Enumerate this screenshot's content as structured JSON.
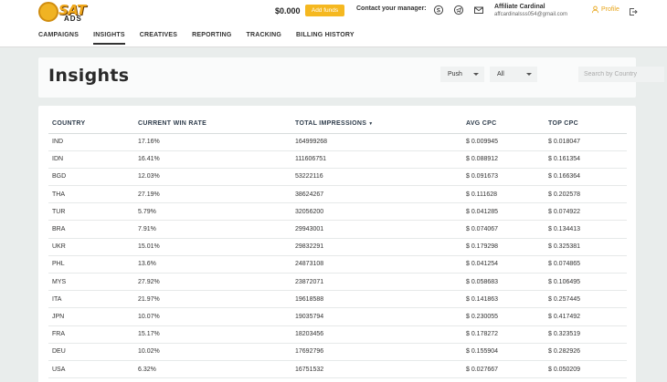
{
  "brand": {
    "logo_text": "SAT",
    "logo_sub": "ADS"
  },
  "header": {
    "balance": "$0.000",
    "add_funds_label": "Add funds",
    "manager_label": "Contact your manager:",
    "manager_icons": [
      "skype-icon",
      "telegram-icon",
      "mail-icon"
    ],
    "affiliate_name": "Affiliate Cardinal",
    "affiliate_email": "affcardinalsss054@gmail.com",
    "profile_label": "Profile"
  },
  "nav": {
    "items": [
      "CAMPAIGNS",
      "INSIGHTS",
      "CREATIVES",
      "REPORTING",
      "TRACKING",
      "BILLING HISTORY"
    ],
    "active": "INSIGHTS"
  },
  "insights": {
    "title": "Insights",
    "filter_type": "Push",
    "filter_scope": "All",
    "search_placeholder": "Search by Country"
  },
  "table": {
    "headers": {
      "country": "COUNTRY",
      "win_rate": "CURRENT WIN RATE",
      "impressions": "TOTAL IMPRESSIONS",
      "avg_cpc": "AVG CPC",
      "top_cpc": "TOP CPC"
    },
    "sort_indicator": "▼",
    "rows": [
      [
        "IND",
        "17.16%",
        "164999268",
        "$ 0.009945",
        "$ 0.018047"
      ],
      [
        "IDN",
        "16.41%",
        "111606751",
        "$ 0.088912",
        "$ 0.161354"
      ],
      [
        "BGD",
        "12.03%",
        "53222116",
        "$ 0.091673",
        "$ 0.166364"
      ],
      [
        "THA",
        "27.19%",
        "38624267",
        "$ 0.111628",
        "$ 0.202578"
      ],
      [
        "TUR",
        "5.79%",
        "32056200",
        "$ 0.041285",
        "$ 0.074922"
      ],
      [
        "BRA",
        "7.91%",
        "29943001",
        "$ 0.074067",
        "$ 0.134413"
      ],
      [
        "UKR",
        "15.01%",
        "29832291",
        "$ 0.179298",
        "$ 0.325381"
      ],
      [
        "PHL",
        "13.6%",
        "24873108",
        "$ 0.041254",
        "$ 0.074865"
      ],
      [
        "MYS",
        "27.92%",
        "23872071",
        "$ 0.058683",
        "$ 0.106495"
      ],
      [
        "ITA",
        "21.97%",
        "19618588",
        "$ 0.141863",
        "$ 0.257445"
      ],
      [
        "JPN",
        "10.07%",
        "19035794",
        "$ 0.230055",
        "$ 0.417492"
      ],
      [
        "FRA",
        "15.17%",
        "18203456",
        "$ 0.178272",
        "$ 0.323519"
      ],
      [
        "DEU",
        "10.02%",
        "17692796",
        "$ 0.155904",
        "$ 0.282926"
      ],
      [
        "USA",
        "6.32%",
        "16751532",
        "$ 0.027667",
        "$ 0.050209"
      ]
    ]
  },
  "colors": {
    "accent": "#f5b820",
    "background": "#e9edec"
  }
}
